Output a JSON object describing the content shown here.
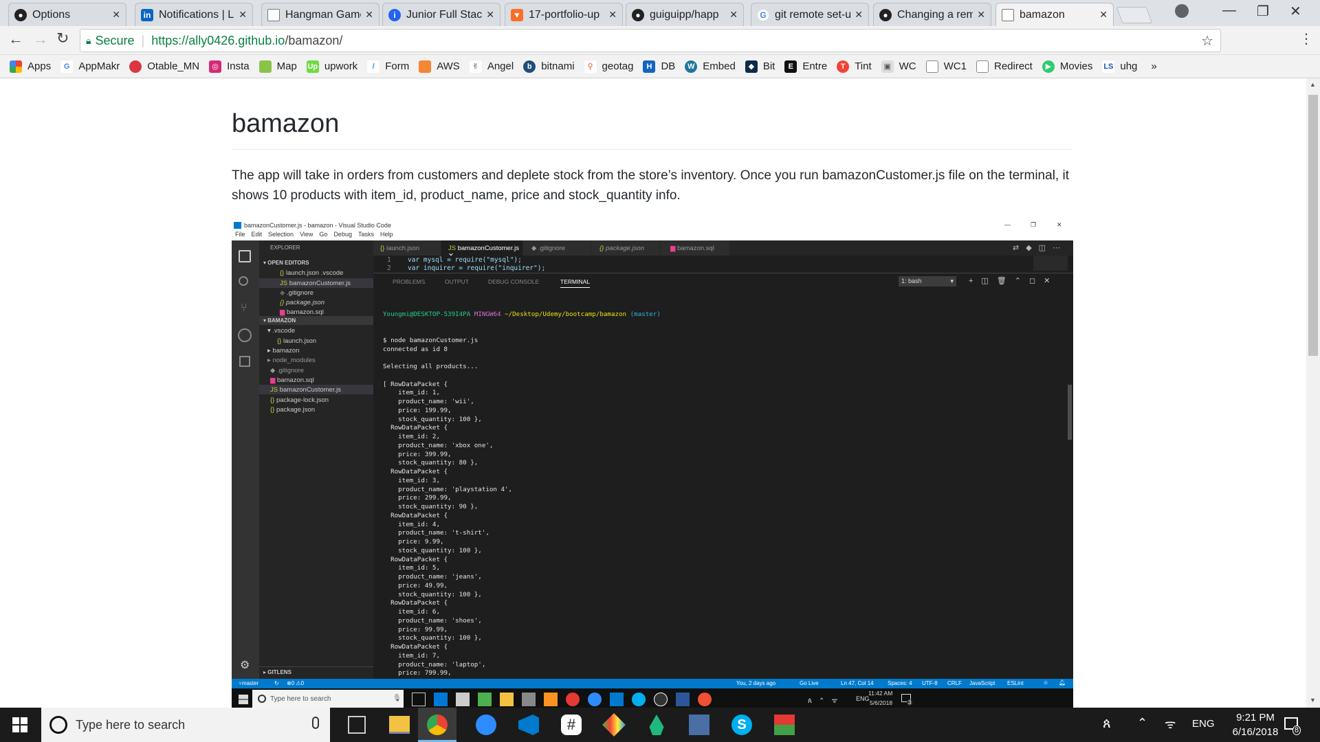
{
  "tabs": [
    {
      "label": "Options",
      "icon": "github-icon"
    },
    {
      "label": "Notifications | L",
      "icon": "linkedin-icon"
    },
    {
      "label": "Hangman Game",
      "icon": "page-icon"
    },
    {
      "label": "Junior Full Stack",
      "icon": "indeed-icon"
    },
    {
      "label": "17-portfolio-up",
      "icon": "gitlab-icon"
    },
    {
      "label": "guiguipp/happ",
      "icon": "github-icon"
    },
    {
      "label": "git remote set-u",
      "icon": "google-icon"
    },
    {
      "label": "Changing a rem",
      "icon": "github-icon"
    },
    {
      "label": "bamazon",
      "icon": "page-icon"
    }
  ],
  "address": {
    "secure": "Secure",
    "url_host": "https://ally0426.github.io",
    "url_path": "/bamazon/"
  },
  "bookmarks": [
    "Apps",
    "AppMakr",
    "Otable_MN",
    "Insta",
    "Map",
    "upwork",
    "Form",
    "AWS",
    "Angel",
    "bitnami",
    "geotag",
    "DB",
    "Embed",
    "Bit",
    "Entre",
    "Tint",
    "WC",
    "WC1",
    "Redirect",
    "Movies",
    "uhg"
  ],
  "content": {
    "title": "bamazon",
    "paragraph": "The app will take in orders from customers and deplete stock from the store’s inventory. Once you run bamazonCustomer.js file on the terminal, it shows 10 products with item_id, product_name, price and stock_quantity info."
  },
  "vscode": {
    "window_title": "bamazonCustomer.js - bamazon - Visual Studio Code",
    "menu": [
      "File",
      "Edit",
      "Selection",
      "View",
      "Go",
      "Debug",
      "Tasks",
      "Help"
    ],
    "explorer_title": "EXPLORER",
    "open_editors_title": "OPEN EDITORS",
    "open_editors": [
      "launch.json .vscode",
      "bamazonCustomer.js",
      ".gitignore",
      "package.json",
      "bamazon.sql"
    ],
    "project_title": "BAMAZON",
    "tree": [
      ".vscode",
      "launch.json",
      "bamazon",
      "node_modules",
      ".gitignore",
      "bamazon.sql",
      "bamazonCustomer.js",
      "package-lock.json",
      "package.json"
    ],
    "gitlens": "GITLENS",
    "editor_tabs": [
      "launch.json",
      "bamazonCustomer.js",
      ".gitignore",
      "package.json",
      "bamazon.sql"
    ],
    "code_lines": [
      {
        "n": "1",
        "text": "var mysql = require(\"mysql\");"
      },
      {
        "n": "2",
        "text": "var inquirer = require(\"inquirer\");"
      }
    ],
    "panel_tabs": [
      "PROBLEMS",
      "OUTPUT",
      "DEBUG CONSOLE",
      "TERMINAL"
    ],
    "terminal_select": "1: bash",
    "prompt_user": "Youngmi@DESKTOP-539I4PA",
    "prompt_shell": "MINGW64",
    "prompt_path": "~/Desktop/Udemy/bootcamp/bamazon",
    "prompt_branch": "(master)",
    "terminal_lines": [
      "$ node bamazonCustomer.js",
      "connected as id 8",
      "",
      "Selecting all products...",
      "",
      "[ RowDataPacket {",
      "    item_id: 1,",
      "    product_name: 'wii',",
      "    price: 199.99,",
      "    stock_quantity: 100 },",
      "  RowDataPacket {",
      "    item_id: 2,",
      "    product_name: 'xbox one',",
      "    price: 399.99,",
      "    stock_quantity: 80 },",
      "  RowDataPacket {",
      "    item_id: 3,",
      "    product_name: 'playstation 4',",
      "    price: 299.99,",
      "    stock_quantity: 90 },",
      "  RowDataPacket {",
      "    item_id: 4,",
      "    product_name: 't-shirt',",
      "    price: 9.99,",
      "    stock_quantity: 100 },",
      "  RowDataPacket {",
      "    item_id: 5,",
      "    product_name: 'jeans',",
      "    price: 49.99,",
      "    stock_quantity: 100 },",
      "  RowDataPacket {",
      "    item_id: 6,",
      "    product_name: 'shoes',",
      "    price: 99.99,",
      "    stock_quantity: 100 },",
      "  RowDataPacket {",
      "    item_id: 7,",
      "    product_name: 'laptop',",
      "    price: 799.99,"
    ],
    "status_left": [
      "master",
      "0",
      "0"
    ],
    "status_right": [
      "You, 2 days ago",
      "Go Live",
      "Ln 47, Col 14",
      "Spaces: 4",
      "UTF-8",
      "CRLF",
      "JavaScript",
      "ESLint"
    ],
    "inner_search": "Type here to search",
    "inner_lang": "ENG",
    "inner_time": "11:42 AM",
    "inner_date": "5/6/2018",
    "inner_notif": "3"
  },
  "taskbar": {
    "search": "Type here to search",
    "lang": "ENG",
    "time": "9:21 PM",
    "date": "6/16/2018",
    "notif": "8"
  },
  "colors": {
    "chrome_tabstrip": "#dee1e6",
    "vscode_sidebar": "#252526",
    "vscode_editor": "#1e1e1e",
    "status_blue": "#007acc",
    "taskbar": "#1b1b1b"
  }
}
